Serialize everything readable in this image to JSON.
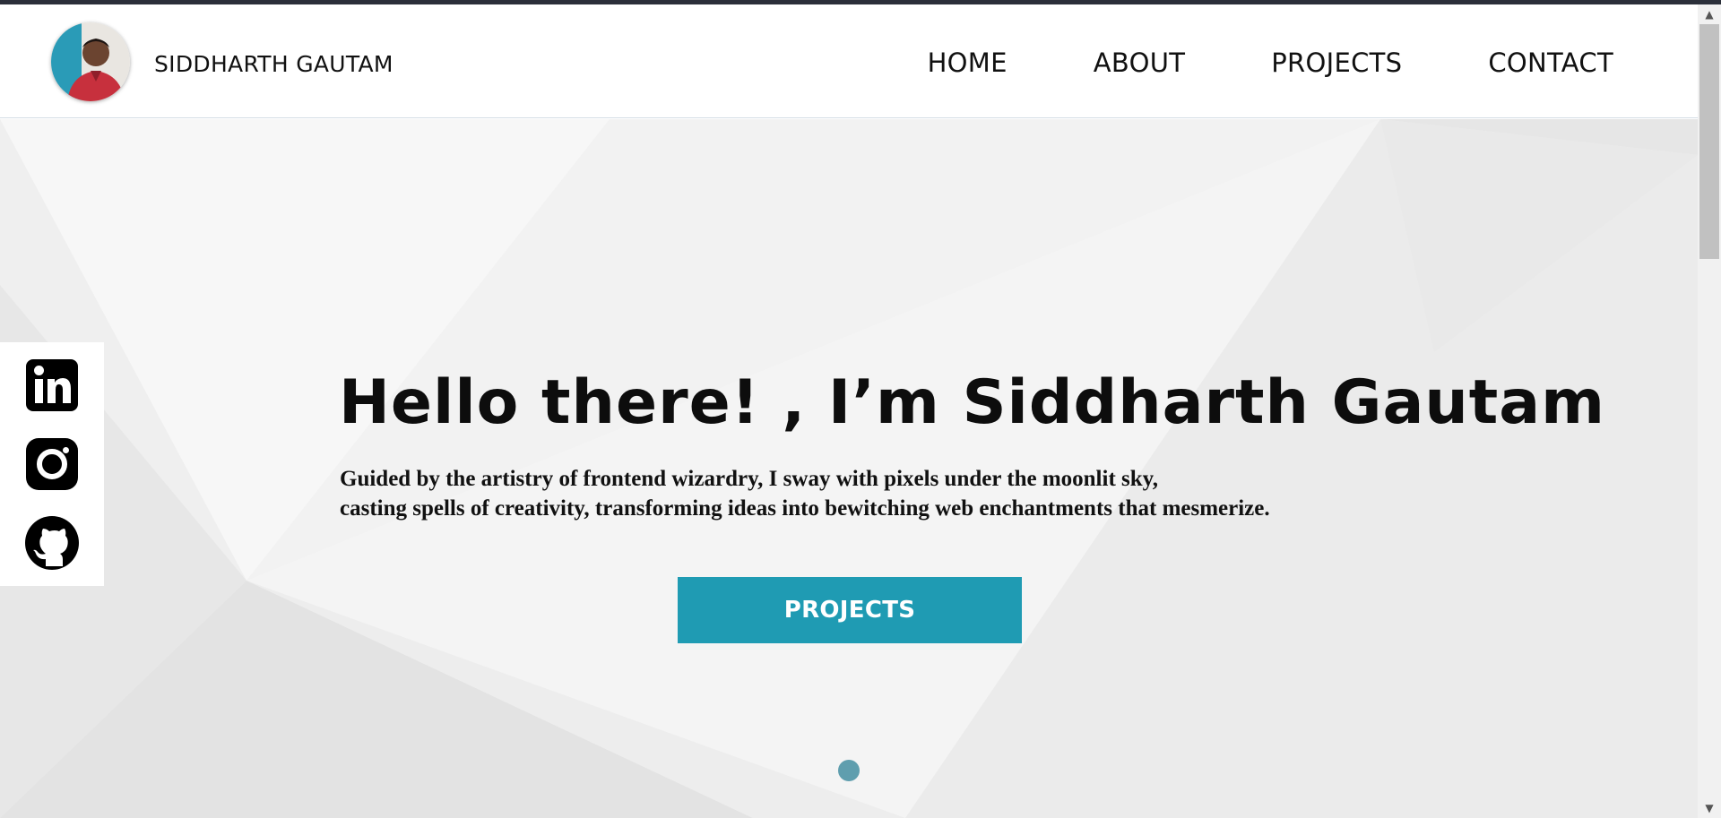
{
  "header": {
    "brand_name": "SIDDHARTH GAUTAM",
    "nav": [
      {
        "label": "HOME"
      },
      {
        "label": "ABOUT"
      },
      {
        "label": "PROJECTS"
      },
      {
        "label": "CONTACT"
      }
    ]
  },
  "social": [
    {
      "icon": "linkedin-icon"
    },
    {
      "icon": "instagram-icon"
    },
    {
      "icon": "github-icon"
    }
  ],
  "hero": {
    "title": "Hello there! , I’m Siddharth Gautam",
    "desc_line1": "Guided by the artistry of frontend wizardry, I sway with pixels under the moonlit sky,",
    "desc_line2": "casting spells of creativity, transforming ideas into bewitching web enchantments that mesmerize.",
    "cta_label": "PROJECTS"
  },
  "colors": {
    "accent": "#1f9bb3",
    "dot": "#5f9eae",
    "text": "#111111",
    "hero_bg": "#f3f3f3"
  }
}
